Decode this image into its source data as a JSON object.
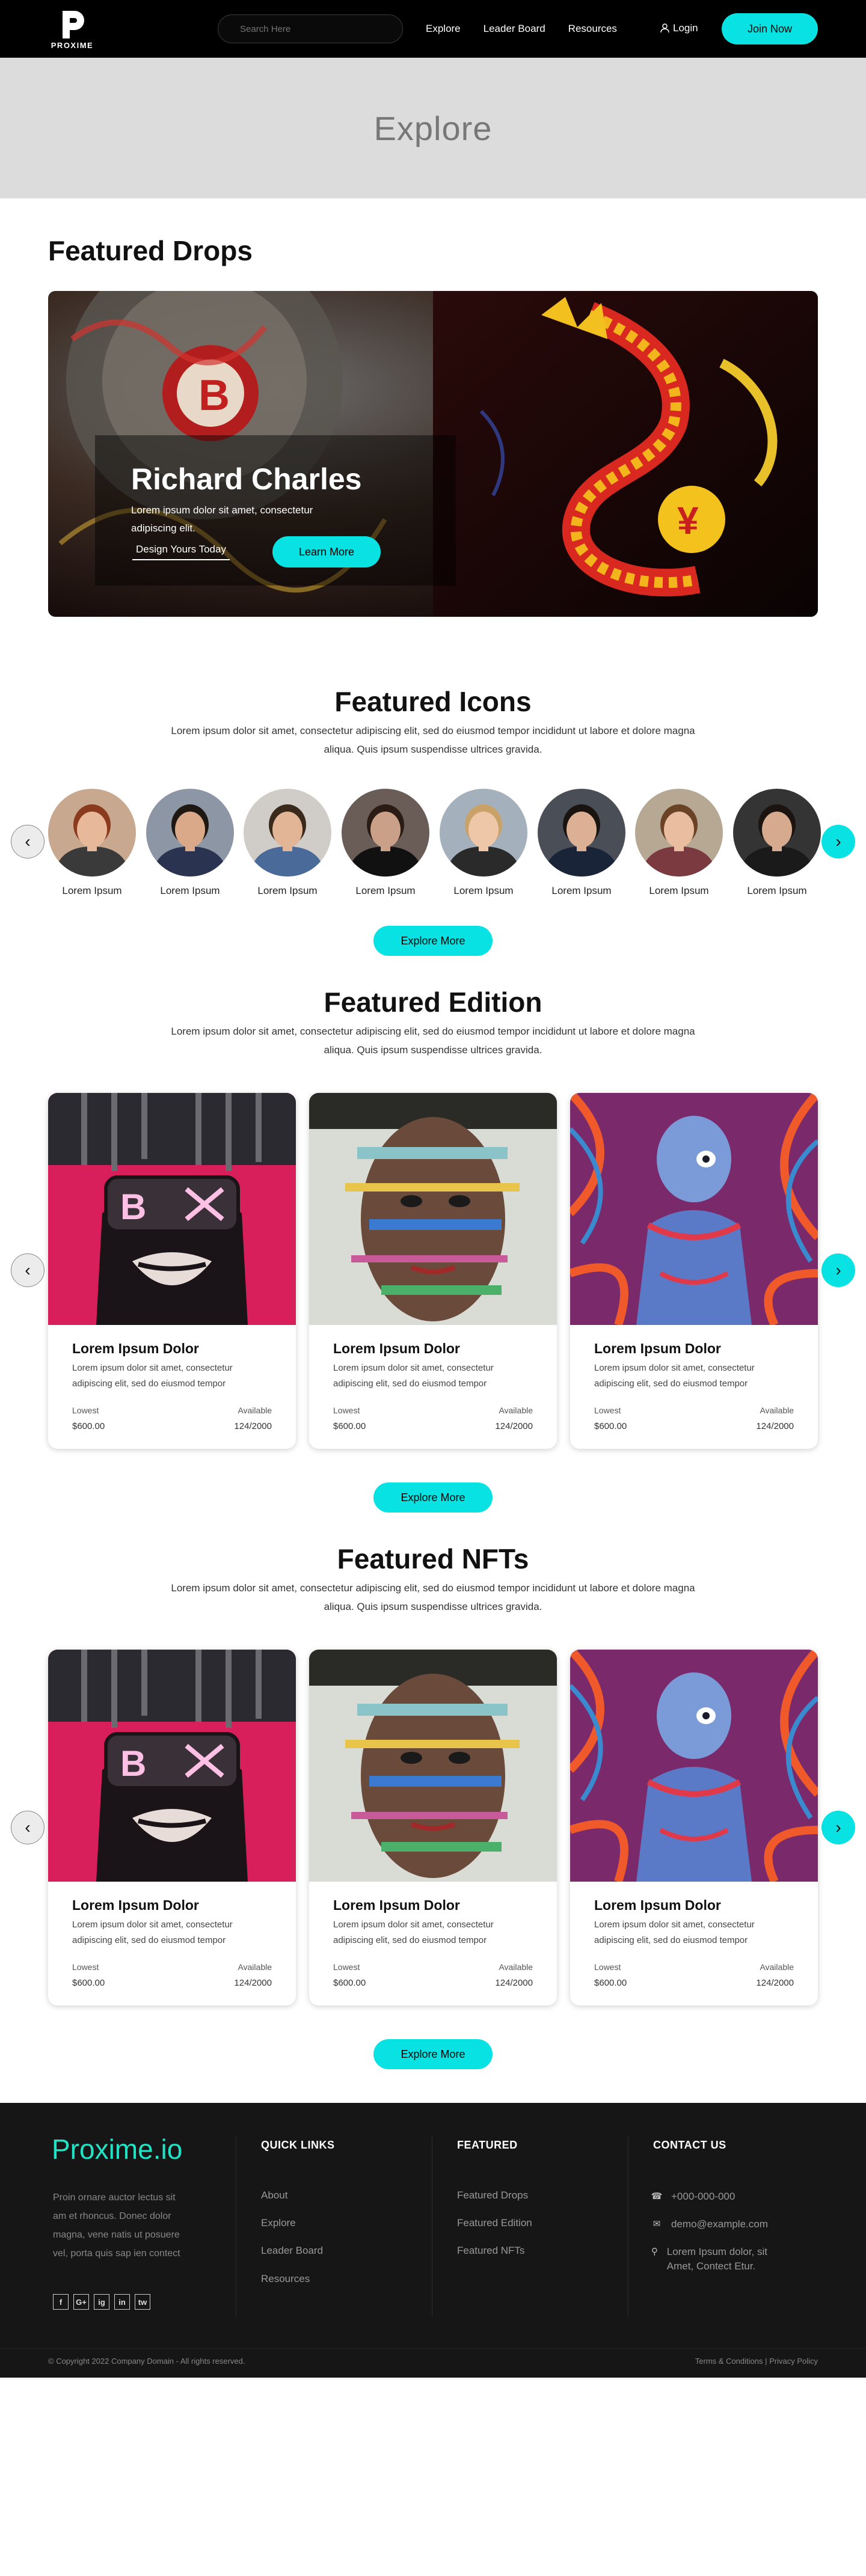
{
  "nav": {
    "logo_text": "PROXIME",
    "search_placeholder": "Search Here",
    "links": [
      "Explore",
      "Leader Board",
      "Resources"
    ],
    "login": "Login",
    "join": "Join Now"
  },
  "hero": {
    "title": "Explore"
  },
  "drops": {
    "title": "Featured Drops",
    "name": "Richard Charles",
    "desc": "Lorem ipsum dolor sit amet, consectetur adipiscing elit.",
    "design_link": "Design Yours Today",
    "learn_btn": "Learn More"
  },
  "icons": {
    "title": "Featured Icons",
    "desc": "Lorem ipsum dolor sit amet, consectetur adipiscing elit, sed do eiusmod tempor incididunt ut labore et dolore magna aliqua. Quis ipsum suspendisse ultrices gravida.",
    "items": [
      "Lorem Ipsum",
      "Lorem Ipsum",
      "Lorem Ipsum",
      "Lorem Ipsum",
      "Lorem Ipsum",
      "Lorem Ipsum",
      "Lorem Ipsum",
      "Lorem Ipsum"
    ],
    "explore_btn": "Explore More"
  },
  "edition": {
    "title": "Featured Edition",
    "desc": "Lorem ipsum dolor sit amet, consectetur adipiscing elit, sed do eiusmod tempor incididunt ut labore et dolore magna aliqua. Quis ipsum suspendisse ultrices gravida.",
    "cards": [
      {
        "title": "Lorem Ipsum Dolor",
        "desc": "Lorem ipsum dolor sit amet, consectetur adipiscing elit, sed do eiusmod tempor",
        "lowest_label": "Lowest",
        "lowest": "$600.00",
        "avail_label": "Available",
        "avail": "124/2000"
      },
      {
        "title": "Lorem Ipsum Dolor",
        "desc": "Lorem ipsum dolor sit amet, consectetur adipiscing elit, sed do eiusmod tempor",
        "lowest_label": "Lowest",
        "lowest": "$600.00",
        "avail_label": "Available",
        "avail": "124/2000"
      },
      {
        "title": "Lorem Ipsum Dolor",
        "desc": "Lorem ipsum dolor sit amet, consectetur adipiscing elit, sed do eiusmod tempor",
        "lowest_label": "Lowest",
        "lowest": "$600.00",
        "avail_label": "Available",
        "avail": "124/2000"
      }
    ],
    "explore_btn": "Explore More"
  },
  "nfts": {
    "title": "Featured NFTs",
    "desc": "Lorem ipsum dolor sit amet, consectetur adipiscing elit, sed do eiusmod tempor incididunt ut labore et dolore magna aliqua. Quis ipsum suspendisse ultrices gravida.",
    "cards": [
      {
        "title": "Lorem Ipsum Dolor",
        "desc": "Lorem ipsum dolor sit amet, consectetur adipiscing elit, sed do eiusmod tempor",
        "lowest_label": "Lowest",
        "lowest": "$600.00",
        "avail_label": "Available",
        "avail": "124/2000"
      },
      {
        "title": "Lorem Ipsum Dolor",
        "desc": "Lorem ipsum dolor sit amet, consectetur adipiscing elit, sed do eiusmod tempor",
        "lowest_label": "Lowest",
        "lowest": "$600.00",
        "avail_label": "Available",
        "avail": "124/2000"
      },
      {
        "title": "Lorem Ipsum Dolor",
        "desc": "Lorem ipsum dolor sit amet, consectetur adipiscing elit, sed do eiusmod tempor",
        "lowest_label": "Lowest",
        "lowest": "$600.00",
        "avail_label": "Available",
        "avail": "124/2000"
      }
    ],
    "explore_btn": "Explore More"
  },
  "footer": {
    "brand": "Proxime.io",
    "about": "Proin ornare auctor lectus sit am et rhoncus. Donec dolor magna, vene natis ut posuere vel, porta quis sap ien contect",
    "social": [
      "f",
      "G+",
      "ig",
      "in",
      "tw"
    ],
    "quick_title": "QUICK LINKS",
    "quick_links": [
      "About",
      "Explore",
      "Leader Board",
      "Resources"
    ],
    "featured_title": "FEATURED",
    "featured_links": [
      "Featured Drops",
      "Featured Edition",
      "Featured NFTs"
    ],
    "contact_title": "CONTACT US",
    "phone": "+000-000-000",
    "email": "demo@example.com",
    "address": "Lorem Ipsum dolor, sit Amet, Contect Etur.",
    "copyright": "© Copyright 2022 Company Domain - All rights reserved.",
    "terms": "Terms & Conditions | Privacy Policy"
  },
  "colors": {
    "accent": "#08e2e2",
    "brand_footer": "#1fe3c4",
    "nav_bg": "#000000",
    "footer_bg": "#161616"
  }
}
